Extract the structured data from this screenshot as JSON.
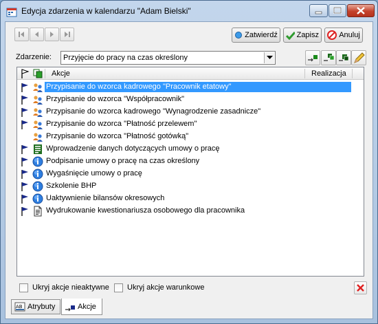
{
  "window": {
    "title": "Edycja zdarzenia w kalendarzu \"Adam Bielski\""
  },
  "toolbar": {
    "confirm_label": "Zatwierdź",
    "save_label": "Zapisz",
    "cancel_label": "Anuluj"
  },
  "event": {
    "label": "Zdarzenie:",
    "value": "Przyjęcie do pracy na czas określony"
  },
  "list": {
    "col_actions": "Akcje",
    "col_realization": "Realizacja",
    "rows": [
      {
        "text": "Przypisanie do wzorca kadrowego \"Pracownik etatowy\"",
        "icon": "people-icon",
        "flag": true,
        "selected": true
      },
      {
        "text": "Przypisanie do wzorca \"Współpracownik\"",
        "icon": "people-icon",
        "flag": true
      },
      {
        "text": "Przypisanie do wzorca kadrowego \"Wynagrodzenie zasadnicze\"",
        "icon": "people-icon",
        "flag": true
      },
      {
        "text": "Przypisanie do wzorca \"Płatność przelewem\"",
        "icon": "people-icon",
        "flag": true
      },
      {
        "text": "Przypisanie do wzorca \"Płatność gotówką\"",
        "icon": "people-icon",
        "flag": false
      },
      {
        "text": "Wprowadzenie danych dotyczących umowy o pracę",
        "icon": "form-icon",
        "flag": true
      },
      {
        "text": "Podpisanie umowy o pracę na czas określony",
        "icon": "globe-info-icon",
        "flag": true
      },
      {
        "text": "Wygaśnięcie umowy o pracę",
        "icon": "globe-info-icon",
        "flag": true
      },
      {
        "text": "Szkolenie BHP",
        "icon": "globe-info-icon",
        "flag": true
      },
      {
        "text": "Uaktywnienie bilansów okresowych",
        "icon": "globe-info-icon",
        "flag": true
      },
      {
        "text": "Wydrukowanie kwestionariusza osobowego dla pracownika",
        "icon": "document-icon",
        "flag": true
      }
    ]
  },
  "options": {
    "hide_inactive": "Ukryj akcje nieaktywne",
    "hide_conditional": "Ukryj akcje warunkowe"
  },
  "tabs": {
    "attributes": "Atrybuty",
    "actions": "Akcje"
  }
}
